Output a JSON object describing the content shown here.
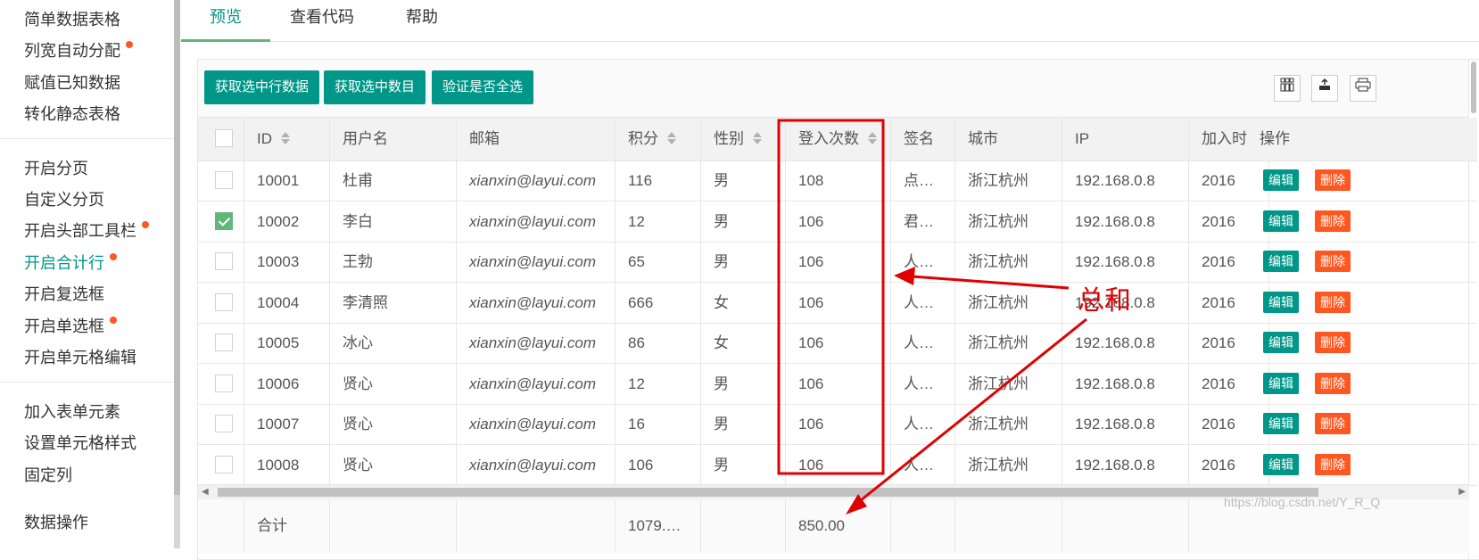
{
  "sidebar": {
    "items": [
      {
        "label": "简单数据表格",
        "dot": false
      },
      {
        "label": "列宽自动分配",
        "dot": true
      },
      {
        "label": "赋值已知数据",
        "dot": false
      },
      {
        "label": "转化静态表格",
        "dot": false
      },
      {
        "label": "开启分页",
        "dot": false
      },
      {
        "label": "自定义分页",
        "dot": false
      },
      {
        "label": "开启头部工具栏",
        "dot": true
      },
      {
        "label": "开启合计行",
        "dot": true,
        "active": true
      },
      {
        "label": "开启复选框",
        "dot": false
      },
      {
        "label": "开启单选框",
        "dot": true
      },
      {
        "label": "开启单元格编辑",
        "dot": false
      },
      {
        "label": "加入表单元素",
        "dot": false
      },
      {
        "label": "设置单元格样式",
        "dot": false
      },
      {
        "label": "固定列",
        "dot": false
      },
      {
        "label": "数据操作",
        "dot": false
      }
    ]
  },
  "tabs": [
    "预览",
    "查看代码",
    "帮助"
  ],
  "toolbar": {
    "buttons": [
      "获取选中行数据",
      "获取选中数目",
      "验证是否全选"
    ],
    "icons": [
      "columns-icon",
      "export-icon",
      "print-icon"
    ]
  },
  "table": {
    "columns": [
      "ID",
      "用户名",
      "邮箱",
      "积分",
      "性别",
      "登入次数",
      "签名",
      "城市",
      "IP",
      "加入时间",
      "操作"
    ],
    "sortable": [
      true,
      false,
      false,
      true,
      true,
      true,
      false,
      false,
      false,
      false,
      false
    ],
    "rows": [
      {
        "id": "10001",
        "name": "杜甫",
        "email": "xianxin@layui.com",
        "score": "116",
        "sex": "男",
        "logins": "108",
        "sign": "点…",
        "city": "浙江杭州",
        "ip": "192.168.0.8",
        "join": "2016",
        "checked": false
      },
      {
        "id": "10002",
        "name": "李白",
        "email": "xianxin@layui.com",
        "score": "12",
        "sex": "男",
        "logins": "106",
        "sign": "君…",
        "city": "浙江杭州",
        "ip": "192.168.0.8",
        "join": "2016",
        "checked": true
      },
      {
        "id": "10003",
        "name": "王勃",
        "email": "xianxin@layui.com",
        "score": "65",
        "sex": "男",
        "logins": "106",
        "sign": "人…",
        "city": "浙江杭州",
        "ip": "192.168.0.8",
        "join": "2016",
        "checked": false
      },
      {
        "id": "10004",
        "name": "李清照",
        "email": "xianxin@layui.com",
        "score": "666",
        "sex": "女",
        "logins": "106",
        "sign": "人…",
        "city": "浙江杭州",
        "ip": "192.168.0.8",
        "join": "2016",
        "checked": false
      },
      {
        "id": "10005",
        "name": "冰心",
        "email": "xianxin@layui.com",
        "score": "86",
        "sex": "女",
        "logins": "106",
        "sign": "人…",
        "city": "浙江杭州",
        "ip": "192.168.0.8",
        "join": "2016",
        "checked": false
      },
      {
        "id": "10006",
        "name": "贤心",
        "email": "xianxin@layui.com",
        "score": "12",
        "sex": "男",
        "logins": "106",
        "sign": "人…",
        "city": "浙江杭州",
        "ip": "192.168.0.8",
        "join": "2016",
        "checked": false
      },
      {
        "id": "10007",
        "name": "贤心",
        "email": "xianxin@layui.com",
        "score": "16",
        "sex": "男",
        "logins": "106",
        "sign": "人…",
        "city": "浙江杭州",
        "ip": "192.168.0.8",
        "join": "2016",
        "checked": false
      },
      {
        "id": "10008",
        "name": "贤心",
        "email": "xianxin@layui.com",
        "score": "106",
        "sex": "男",
        "logins": "106",
        "sign": "人…",
        "city": "浙江杭州",
        "ip": "192.168.0.8",
        "join": "2016",
        "checked": false
      }
    ],
    "row_actions": {
      "edit": "编辑",
      "delete": "删除"
    },
    "total": {
      "label": "合计",
      "score": "1079.…",
      "logins": "850.00"
    }
  },
  "annotation": {
    "text": "总和",
    "color": "#e00000"
  },
  "watermark": "https://blog.csdn.net/Y_R_Q",
  "colors": {
    "primary": "#009688",
    "danger": "#ff5722",
    "dot": "#ff5722",
    "annotation": "#e00000"
  }
}
